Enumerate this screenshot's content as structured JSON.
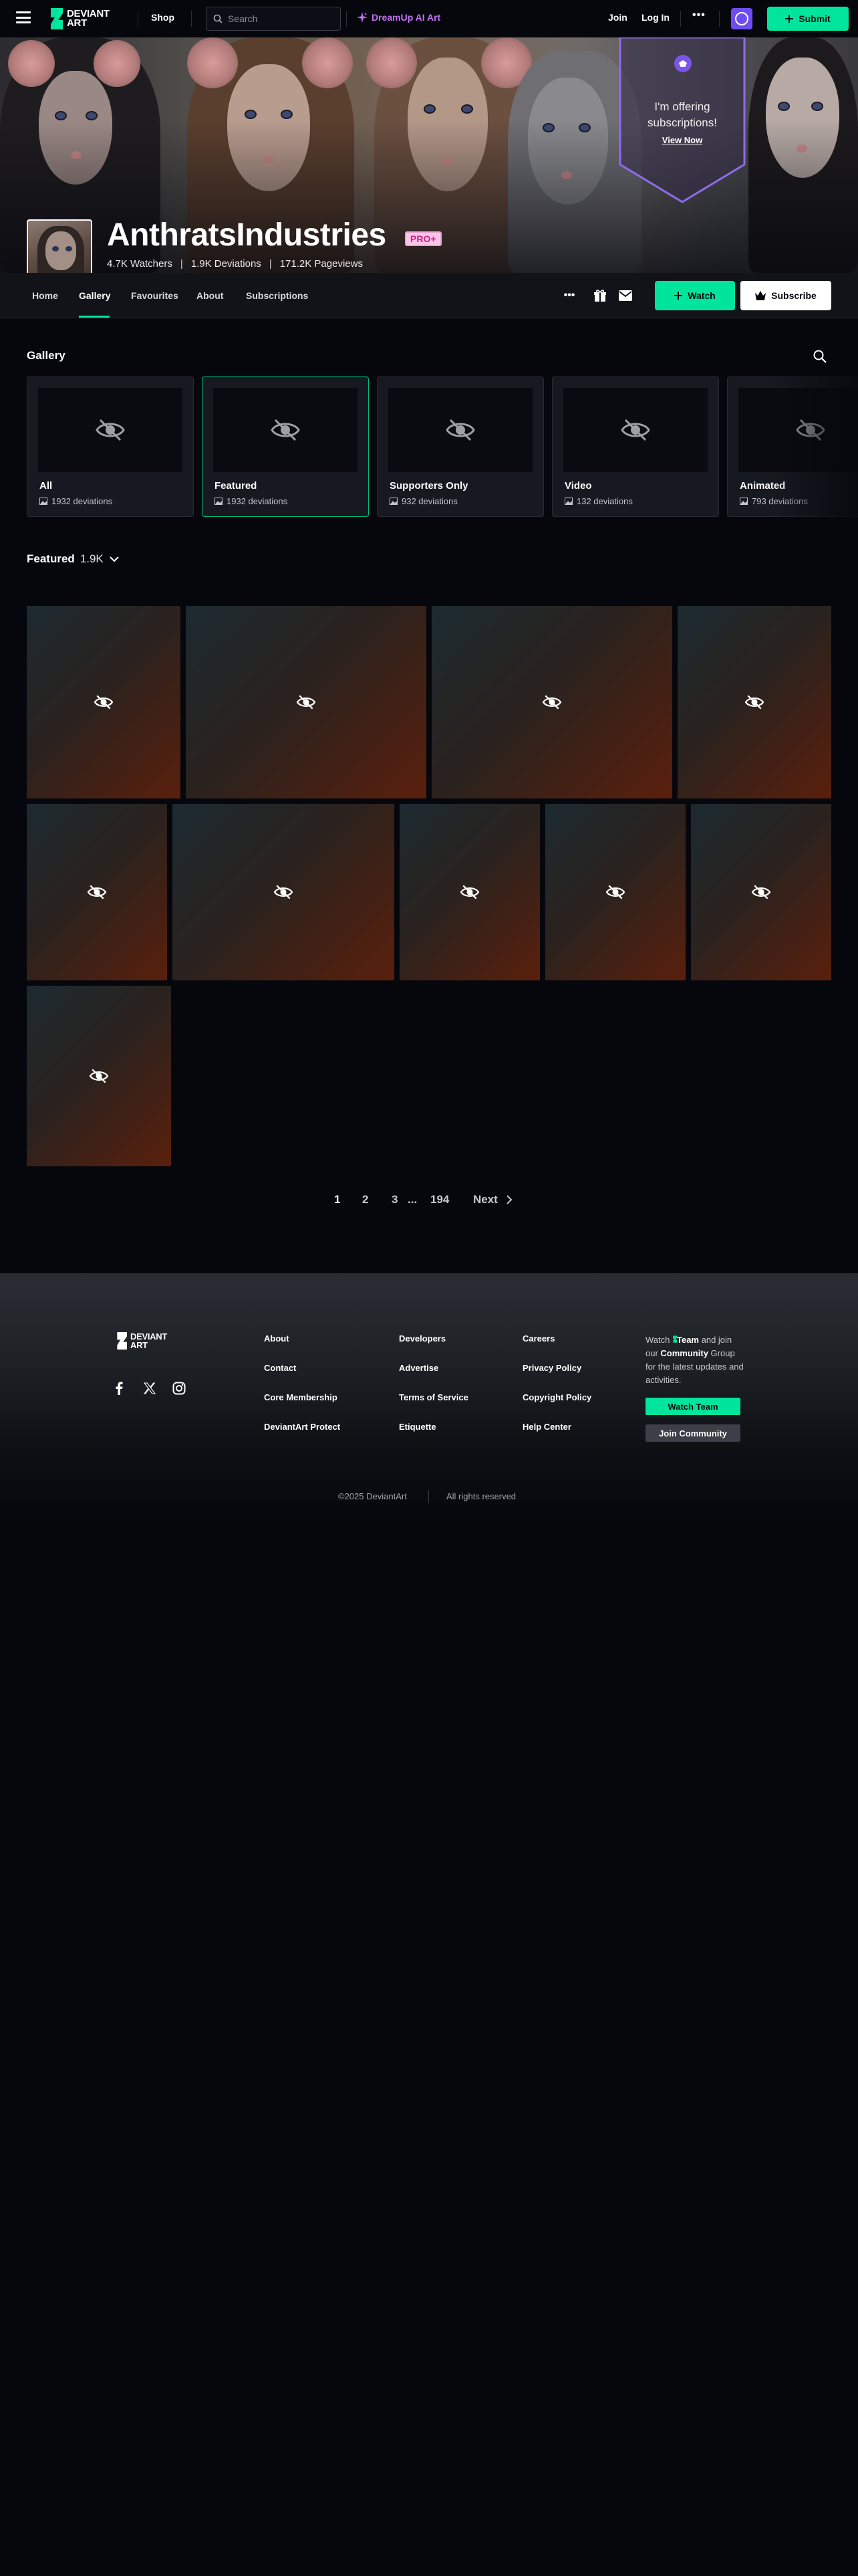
{
  "colors": {
    "accent_green": "#00e59b",
    "dreamup_purple": "#c36ff5",
    "pro_badge_pink": "#ffc3e9",
    "background": "#06070d"
  },
  "topbar": {
    "logo_line1": "DEVIANT",
    "logo_line2": "ART",
    "shop_label": "Shop",
    "search_placeholder": "Search",
    "dreamup_label": "DreamUp AI Art",
    "join_label": "Join",
    "login_label": "Log In",
    "more_label": "•••",
    "submit_label": "Submit"
  },
  "banner": {
    "offer_text": "I'm offering subscriptions!",
    "offer_link": "View Now"
  },
  "profile": {
    "username": "AnthratsIndustries",
    "badge": "PRO+",
    "watchers": "4.7K Watchers",
    "deviations": "1.9K Deviations",
    "pageviews": "171.2K Pageviews",
    "separator": "|"
  },
  "tabs": [
    {
      "label": "Home",
      "active": false
    },
    {
      "label": "Gallery",
      "active": true
    },
    {
      "label": "Favourites",
      "active": false
    },
    {
      "label": "About",
      "active": false
    },
    {
      "label": "Subscriptions",
      "active": false
    }
  ],
  "actions": {
    "more_label": "•••",
    "watch_label": "Watch",
    "subscribe_label": "Subscribe"
  },
  "gallery": {
    "title": "Gallery",
    "folders": [
      {
        "name": "All",
        "count": "1932 deviations",
        "selected": false
      },
      {
        "name": "Featured",
        "count": "1932 deviations",
        "selected": true
      },
      {
        "name": "Supporters Only",
        "count": "932 deviations",
        "selected": false
      },
      {
        "name": "Video",
        "count": "132 deviations",
        "selected": false
      },
      {
        "name": "Animated",
        "count": "793 deviations",
        "selected": false
      }
    ],
    "featured_title": "Featured",
    "featured_count": "1.9K"
  },
  "pagination": {
    "pages": [
      "1",
      "2",
      "3"
    ],
    "ellipsis": "...",
    "last_page": "194",
    "current": "1",
    "next_label": "Next"
  },
  "footer": {
    "logo_line1": "DEVIANT",
    "logo_line2": "ART",
    "col1": [
      "About",
      "Contact",
      "Core Membership",
      "DeviantArt Protect"
    ],
    "col2": [
      "Developers",
      "Advertise",
      "Terms of Service",
      "Etiquette"
    ],
    "col3": [
      "Careers",
      "Privacy Policy",
      "Copyright Policy",
      "Help Center"
    ],
    "cta_watch": "Watch",
    "cta_team": "Team",
    "cta_and": "and join our",
    "cta_community": "Community",
    "cta_rest": "Group for the latest updates and activities.",
    "watch_team_label": "Watch Team",
    "join_community_label": "Join Community",
    "copyright": "©2025 DeviantArt",
    "rights": "All rights reserved"
  }
}
